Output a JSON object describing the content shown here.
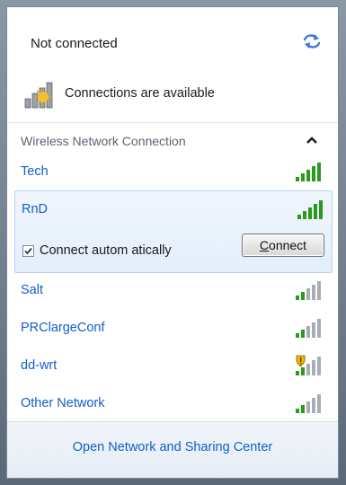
{
  "status": {
    "title": "Not connected",
    "availability": "Connections are available"
  },
  "section": {
    "title": "Wireless Network Connection"
  },
  "networks": [
    {
      "name": "Tech",
      "signal_bars": 5,
      "secured_warning": false
    },
    {
      "name": "RnD",
      "signal_bars": 5,
      "secured_warning": false,
      "selected": true
    },
    {
      "name": "Salt",
      "signal_bars": 2,
      "secured_warning": false
    },
    {
      "name": "PRClargeConf",
      "signal_bars": 2,
      "secured_warning": false
    },
    {
      "name": "dd-wrt",
      "signal_bars": 2,
      "secured_warning": true
    },
    {
      "name": "Other Network",
      "signal_bars": 2,
      "secured_warning": false
    }
  ],
  "selected_network": {
    "connect_auto_label": "Connect autom atically",
    "connect_auto_checked": true,
    "connect_button_first": "C",
    "connect_button_rest": "onnect"
  },
  "footer": {
    "link": "Open Network and Sharing Center"
  },
  "colors": {
    "link": "#1160c9",
    "signal_on": "#2a9a1f",
    "signal_off": "#a8adb3"
  }
}
